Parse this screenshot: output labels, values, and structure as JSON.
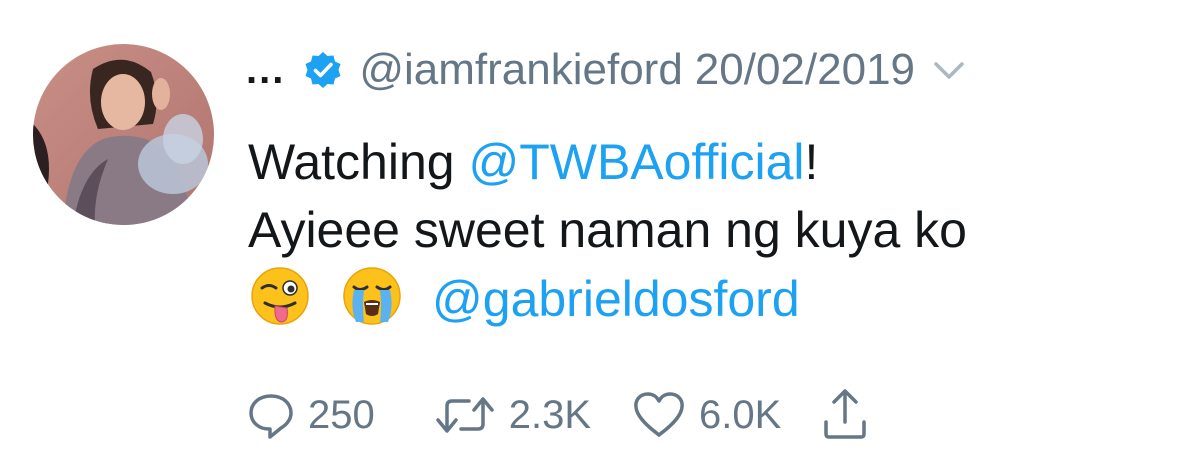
{
  "tweet": {
    "author": {
      "display_name": "...",
      "handle": "@iamfrankieford",
      "verified": true
    },
    "date": "20/02/2019",
    "text": {
      "line1_prefix": "Watching ",
      "mention1": "@TWBAofficial",
      "line1_suffix": "!",
      "line2": "Ayieee sweet naman ng kuya ko",
      "emojis": [
        "winking-face-with-tongue",
        "loudly-crying-face"
      ],
      "mention2": "@gabrieldosford"
    },
    "actions": {
      "replies": "250",
      "retweets": "2.3K",
      "likes": "6.0K"
    }
  },
  "colors": {
    "text": "#14171a",
    "muted": "#657786",
    "link": "#1da1f2",
    "verified": "#1da1f2"
  },
  "icons": [
    "verified-badge-icon",
    "caret-down-icon",
    "reply-icon",
    "retweet-icon",
    "like-icon",
    "share-icon"
  ]
}
